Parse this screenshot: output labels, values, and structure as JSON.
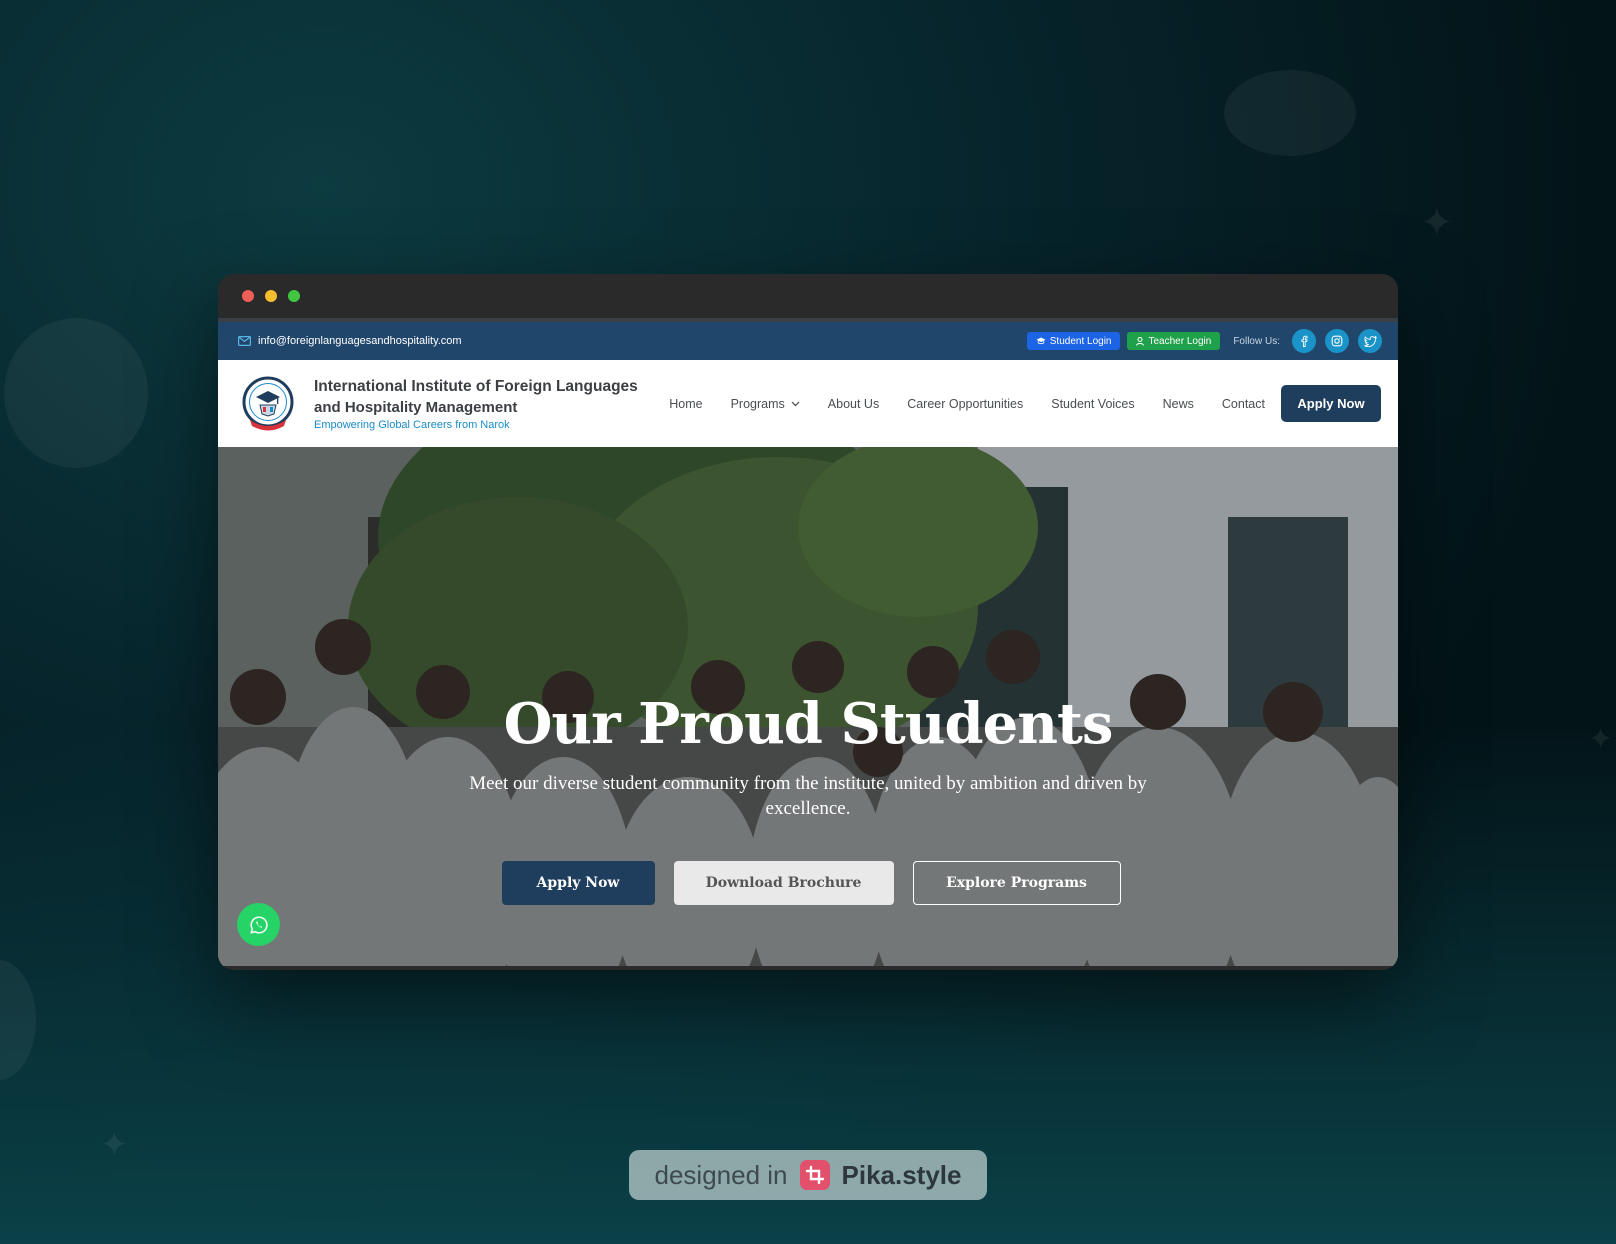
{
  "topbar": {
    "email": "info@foreignlanguagesandhospitality.com",
    "student_login": "Student Login",
    "teacher_login": "Teacher Login",
    "follow_label": "Follow Us:",
    "social": [
      "facebook-icon",
      "instagram-icon",
      "twitter-icon"
    ]
  },
  "brand": {
    "title_line1": "International Institute of Foreign Languages",
    "title_line2": "and Hospitality Management",
    "tagline": "Empowering Global Careers from Narok"
  },
  "nav": {
    "items": [
      "Home",
      "Programs",
      "About Us",
      "Career Opportunities",
      "Student Voices",
      "News",
      "Contact"
    ],
    "apply_label": "Apply Now"
  },
  "hero": {
    "title": "Our Proud Students",
    "subtitle": "Meet our diverse student community from the institute, united by ambition and driven by excellence.",
    "buttons": {
      "apply": "Apply Now",
      "brochure": "Download Brochure",
      "explore": "Explore Programs"
    }
  },
  "footer_badge": {
    "prefix": "designed in",
    "brand": "Pika.style"
  },
  "colors": {
    "primary": "#1f3d5c",
    "topbar": "#21466b",
    "student_login": "#1c63e6",
    "teacher_login": "#1fa04a",
    "social": "#1a94c8",
    "whatsapp": "#25d366",
    "tagline": "#1a8bc6"
  }
}
